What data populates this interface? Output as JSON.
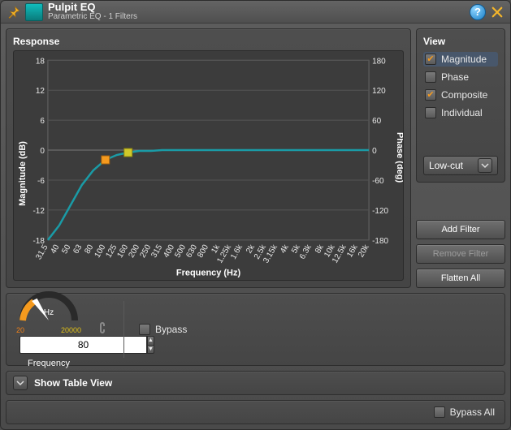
{
  "header": {
    "title": "Pulpit EQ",
    "subtitle": "Parametric EQ - 1 Filters"
  },
  "response": {
    "title": "Response",
    "x_axis_label": "Frequency (Hz)",
    "y_left_label": "Magnitude (dB)",
    "y_right_label": "Phase (deg)"
  },
  "view": {
    "title": "View",
    "items": [
      {
        "label": "Magnitude",
        "checked": true,
        "selected": true
      },
      {
        "label": "Phase",
        "checked": false,
        "selected": false
      },
      {
        "label": "Composite",
        "checked": true,
        "selected": false
      },
      {
        "label": "Individual",
        "checked": false,
        "selected": false
      }
    ],
    "filter_type": "Low-cut"
  },
  "buttons": {
    "add_filter": "Add Filter",
    "remove_filter": "Remove Filter",
    "flatten_all": "Flatten All"
  },
  "freq_control": {
    "unit": "Hz",
    "scale_lo": "20",
    "scale_hi": "20000",
    "value": "80",
    "label": "Frequency",
    "bypass_label": "Bypass",
    "bypass_checked": false
  },
  "table_toggle": {
    "label": "Show Table View"
  },
  "footer": {
    "bypass_all_label": "Bypass All",
    "bypass_all_checked": false
  },
  "chart_data": {
    "type": "line",
    "title": "Response",
    "xlabel": "Frequency (Hz)",
    "ylabel_left": "Magnitude (dB)",
    "ylabel_right": "Phase (deg)",
    "x_scale": "log",
    "x_ticks": [
      "31.5",
      "40",
      "50",
      "63",
      "80",
      "100",
      "125",
      "160",
      "200",
      "250",
      "315",
      "400",
      "500",
      "630",
      "800",
      "1k",
      "1.25k",
      "1.6k",
      "2k",
      "2.5k",
      "3.15k",
      "4k",
      "5k",
      "6.3k",
      "8k",
      "10k",
      "12.5k",
      "16k",
      "20k"
    ],
    "y_left_ticks": [
      -18,
      -12,
      -6,
      0,
      6,
      12,
      18
    ],
    "y_right_ticks": [
      -180,
      -120,
      -60,
      0,
      60,
      120,
      180
    ],
    "ylim_left": [
      -18,
      18
    ],
    "ylim_right": [
      -180,
      180
    ],
    "series": [
      {
        "name": "Magnitude",
        "axis": "left",
        "x": [
          31.5,
          40,
          50,
          63,
          80,
          100,
          125,
          160,
          200,
          250,
          315,
          400,
          500,
          630,
          800,
          1000,
          2000,
          5000,
          10000,
          20000
        ],
        "y": [
          -18,
          -15,
          -11,
          -7,
          -4,
          -2,
          -1,
          -0.5,
          -0.2,
          -0.1,
          0,
          0,
          0,
          0,
          0,
          0,
          0,
          0,
          0,
          0
        ]
      }
    ],
    "handles": [
      {
        "color": "#f59a1e",
        "x": 100,
        "y": -2
      },
      {
        "color": "#d0c82a",
        "x": 160,
        "y": -0.5
      }
    ]
  }
}
